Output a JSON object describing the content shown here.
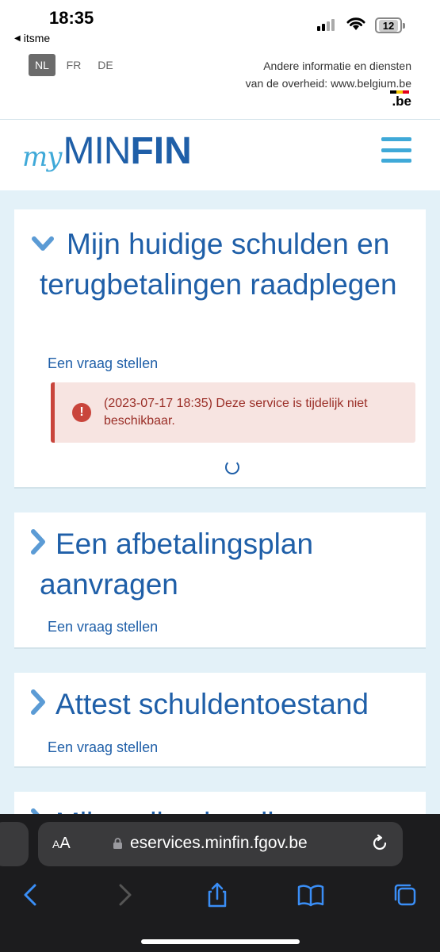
{
  "status_bar": {
    "time": "18:35",
    "back_app": "itsme",
    "battery": "12"
  },
  "language_bar": {
    "languages": [
      "NL",
      "FR",
      "DE"
    ],
    "active": "NL",
    "belgium_line1": "Andere informatie en diensten",
    "belgium_line2": "van de overheid: www.belgium.be",
    "be_logo": ".be"
  },
  "header": {
    "logo_my": "my",
    "logo_min": "MIN",
    "logo_fin": "FIN",
    "menu_icon": "hamburger-icon"
  },
  "cards": [
    {
      "title": "Mijn huidige schulden en terugbetalingen raadplegen",
      "ask": "Een vraag stellen",
      "expanded": true,
      "alert": "(2023-07-17 18:35) Deze service is tijdelijk niet beschikbaar."
    },
    {
      "title": "Een afbetalingsplan aanvragen",
      "ask": "Een vraag stellen",
      "expanded": false
    },
    {
      "title": "Attest schuldentoestand",
      "ask": "Een vraag stellen",
      "expanded": false
    },
    {
      "title": "Mijn online betalingen",
      "expanded": false
    }
  ],
  "browser": {
    "text_size_label": "AA",
    "url": "eservices.minfin.fgov.be"
  },
  "colors": {
    "brand_blue": "#1f5fa8",
    "accent_blue": "#3fa9d8",
    "alert_red": "#c9453c"
  }
}
